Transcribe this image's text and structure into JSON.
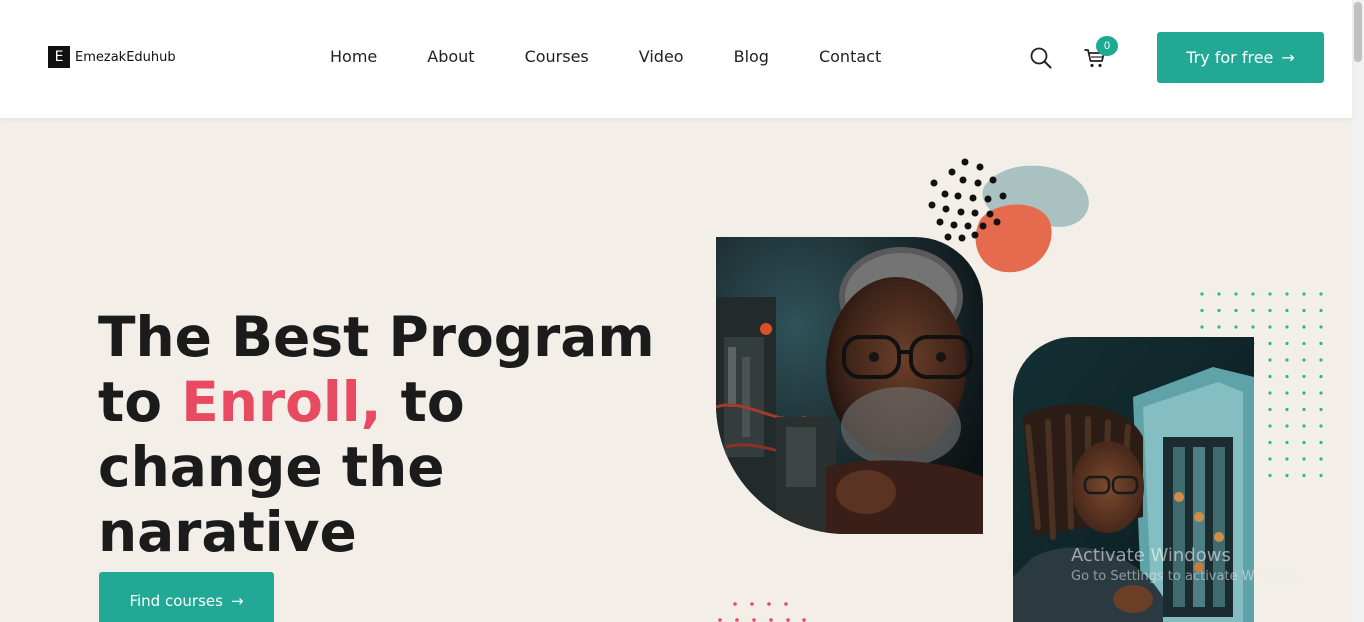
{
  "header": {
    "logo_mark": "E",
    "logo_text": "EmezakEduhub",
    "nav": [
      "Home",
      "About",
      "Courses",
      "Video",
      "Blog",
      "Contact"
    ],
    "cart_count": "0",
    "cta_label": "Try for free",
    "cta_arrow": "→"
  },
  "hero": {
    "title_line1": "The Best Program",
    "title_to": "to ",
    "title_accent": "Enroll,",
    "title_after": " to",
    "title_line3": "change the",
    "title_line4": "narative",
    "button_label": "Find courses",
    "button_arrow": "→"
  },
  "watermark": {
    "title": "Activate Windows",
    "subtitle": "Go to Settings to activate Windows."
  },
  "colors": {
    "accent_teal": "#21a995",
    "accent_pink": "#e84a61",
    "hero_bg": "#f3efe8",
    "blob_grey": "#a9c2c1",
    "blob_orange": "#e66a4e"
  },
  "icons": {
    "search": "search-icon",
    "cart": "cart-icon",
    "arrow": "arrow-right-icon"
  }
}
